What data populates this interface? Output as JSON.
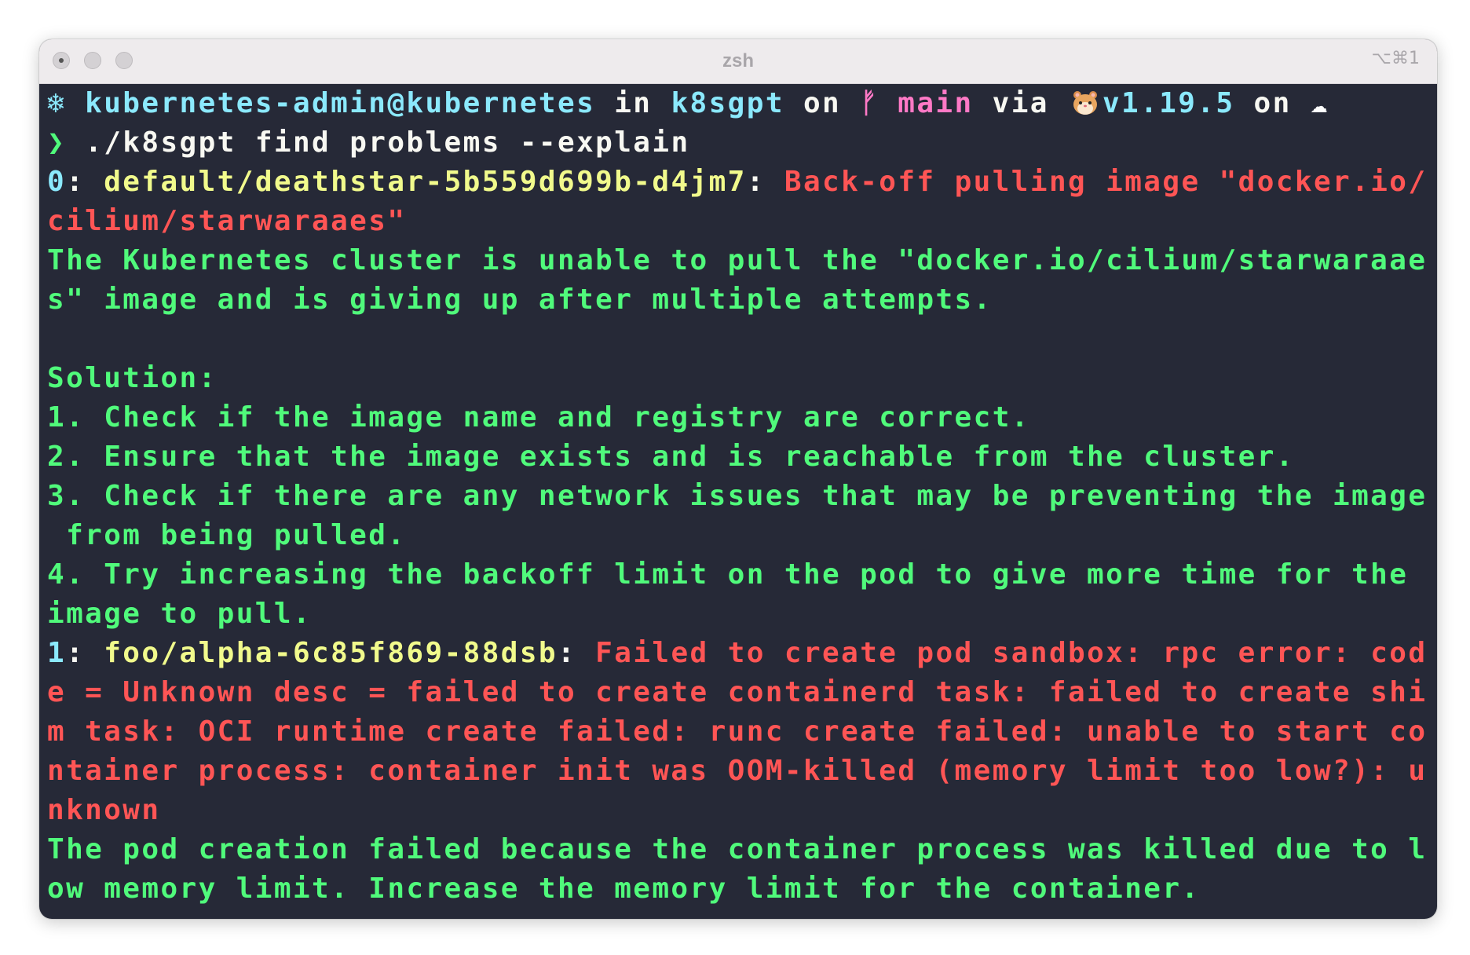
{
  "window": {
    "title": "zsh",
    "shortcut": "⌥⌘1"
  },
  "prompt": {
    "k8s_icon": "❄",
    "context": "kubernetes-admin@kubernetes",
    "in_word": " in ",
    "directory": "k8sgpt",
    "on_word": " on ",
    "git_icon": "ᚠ",
    "branch": "main",
    "via_word": " via ",
    "go_icon": "hamster-icon",
    "version": "v1.19.5",
    "on_word2": " on ",
    "cloud_icon": "☁"
  },
  "command": {
    "chevron": "❯",
    "text": "./k8sgpt find problems --explain"
  },
  "problems": [
    {
      "index": "0",
      "sep": ": ",
      "name": "default/deathstar-5b559d699b-d4jm7",
      "name_sep": ": ",
      "error_lines": [
        "Back-off pulling image \"docker.io/",
        "cilium/starwaraaes\""
      ],
      "explain_lines": [
        "The Kubernetes cluster is unable to pull the \"docker.io/cilium/starwaraae",
        "s\" image and is giving up after multiple attempts.",
        "",
        "Solution:",
        "1. Check if the image name and registry are correct.",
        "2. Ensure that the image exists and is reachable from the cluster.",
        "3. Check if there are any network issues that may be preventing the image",
        " from being pulled.",
        "4. Try increasing the backoff limit on the pod to give more time for the",
        "image to pull."
      ]
    },
    {
      "index": "1",
      "sep": ": ",
      "name": "foo/alpha-6c85f869-88dsb",
      "name_sep": ": ",
      "error_lines": [
        "Failed to create pod sandbox: rpc error: cod",
        "e = Unknown desc = failed to create containerd task: failed to create shi",
        "m task: OCI runtime create failed: runc create failed: unable to start co",
        "ntainer process: container init was OOM-killed (memory limit too low?): u",
        "nknown"
      ],
      "explain_lines": [
        "The pod creation failed because the container process was killed due to l",
        "ow memory limit. Increase the memory limit for the container."
      ]
    }
  ],
  "colors": {
    "background": "#262937",
    "cyan": "#8be9fd",
    "pink": "#ff79c6",
    "green": "#50fa7b",
    "yellow": "#f1fa8c",
    "red": "#ff5555",
    "foreground": "#f8f8f2"
  }
}
